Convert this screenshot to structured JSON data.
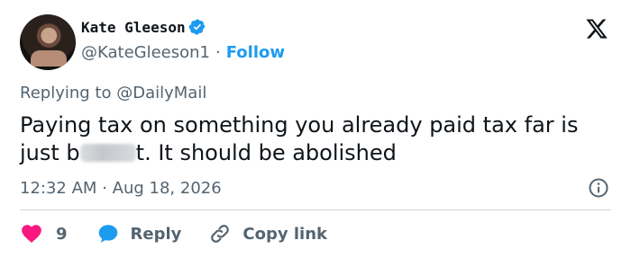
{
  "author": {
    "name": "Kate Gleeson",
    "handle": "@KateGleeson1",
    "separator": "·",
    "follow_label": "Follow"
  },
  "reply": {
    "prefix": "Replying to",
    "mention": "@DailyMail"
  },
  "post": {
    "text_part1": "Paying tax on something you already paid tax far is just b",
    "text_part2": "t. It should be abolished"
  },
  "meta": {
    "time": "12:32 AM",
    "separator": "·",
    "date": "Aug 18, 2026"
  },
  "actions": {
    "like_count": "9",
    "reply_label": "Reply",
    "copy_link_label": "Copy link"
  },
  "colors": {
    "accent": "#1d9bf0",
    "like": "#f91880",
    "muted": "#536471"
  }
}
